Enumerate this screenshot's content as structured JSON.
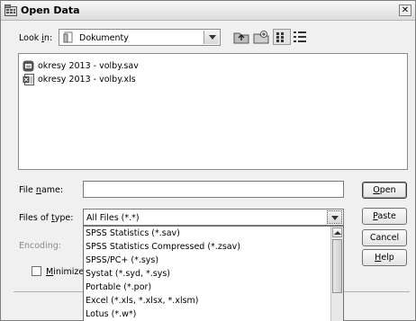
{
  "window": {
    "title": "Open Data"
  },
  "lookin": {
    "label_pre": "Look ",
    "label_u": "i",
    "label_post": "n:",
    "value": "Dokumenty"
  },
  "toolbar": {
    "up_icon": "up-folder-icon",
    "new_icon": "new-folder-icon",
    "list_icon": "list-view-icon",
    "details_icon": "details-view-icon"
  },
  "files": [
    {
      "name": "okresy 2013 - volby.sav",
      "icon": "spss-data-icon"
    },
    {
      "name": "okresy 2013 - volby.xls",
      "icon": "excel-file-icon"
    }
  ],
  "filename": {
    "label_pre": "File ",
    "label_u": "n",
    "label_post": "ame:",
    "value": ""
  },
  "filetype": {
    "label_pre": "Files of ",
    "label_u": "t",
    "label_post": "ype:",
    "value": "All Files (*.*)"
  },
  "encoding": {
    "label": "Encoding:"
  },
  "minimize": {
    "label_pre": "",
    "label_u": "M",
    "label_post": "inimize s"
  },
  "buttons": {
    "open_u": "O",
    "open_rest": "pen",
    "paste_u": "P",
    "paste_rest": "aste",
    "cancel": "Cancel",
    "help_u": "H",
    "help_rest": "elp"
  },
  "dropdown_options": [
    "SPSS Statistics (*.sav)",
    "SPSS Statistics Compressed (*.zsav)",
    "SPSS/PC+ (*.sys)",
    "Systat (*.syd, *.sys)",
    "Portable (*.por)",
    "Excel (*.xls, *.xlsx, *.xlsm)",
    "Lotus (*.w*)"
  ]
}
